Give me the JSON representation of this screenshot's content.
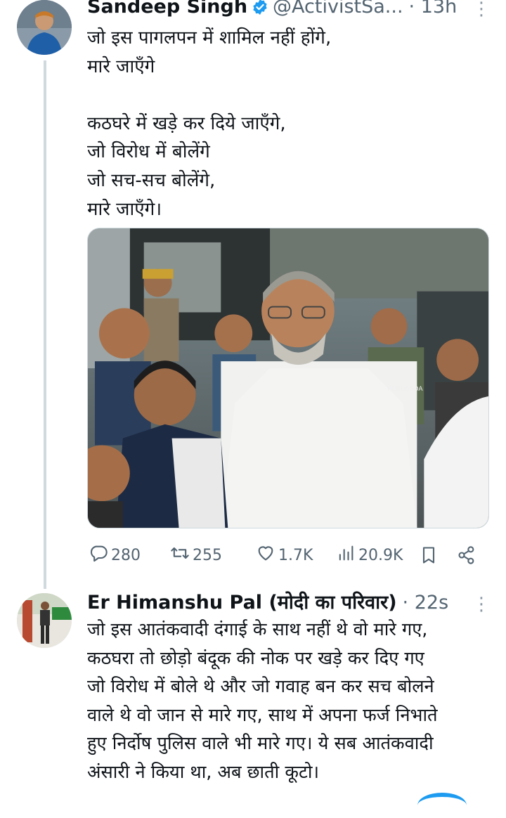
{
  "tweet1": {
    "author": "Sandeep Singh",
    "handle": "@ActivistSa...",
    "time": "· 13h",
    "body": "जो इस पागलपन में शामिल नहीं होंगे,\nमारे जाएँगे\n\nकठघरे में खड़े कर दिये जाएँगे,\nजो विरोध में बोलेंगे\nजो सच-सच बोलेंगे,\nमारे जाएँगे।",
    "media_text": "PUBLISSDA",
    "actions": {
      "replies": "280",
      "retweets": "255",
      "likes": "1.7K",
      "views": "20.9K"
    }
  },
  "tweet2": {
    "author": "Er Himanshu Pal (मोदी का परिवार)",
    "time": "· 22s",
    "body": "जो इस आतंकवादी दंगाई के साथ नहीं थे वो मारे गए,\nकठघरा तो छोड़ो बंदूक की नोक पर खड़े कर दिए गए\nजो विरोध में बोले थे और जो गवाह बन कर सच बोलने\nवाले थे वो जान से मारे गए, साथ में अपना फर्ज निभाते\nहुए निर्दोष पुलिस वाले भी मारे गए। ये सब आतंकवादी\nअंसारी ने किया था, अब छाती कूटो।"
  },
  "colors": {
    "text": "#0f1419",
    "muted": "#536471",
    "verified": "#1d9bf0",
    "thread_line": "#cfd9de"
  },
  "icons": [
    "verified-badge-icon",
    "more-icon",
    "reply-icon",
    "retweet-icon",
    "like-icon",
    "views-icon",
    "bookmark-icon",
    "share-icon"
  ]
}
